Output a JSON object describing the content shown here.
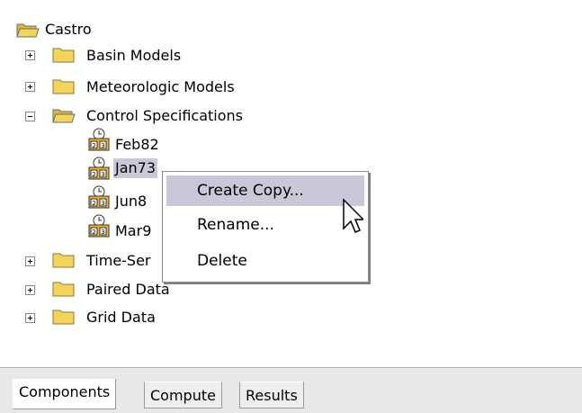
{
  "tree": {
    "root": {
      "label": "Castro",
      "icon": "open-folder-icon"
    },
    "nodes": [
      {
        "label": "Basin Models",
        "state": "collapsed",
        "icon": "folder-icon"
      },
      {
        "label": "Meteorologic Models",
        "state": "collapsed",
        "icon": "folder-icon"
      },
      {
        "label": "Control Specifications",
        "state": "expanded",
        "icon": "open-folder-icon",
        "children": [
          {
            "label": "Feb82",
            "icon": "calendar-clock-icon"
          },
          {
            "label": "Jan73",
            "icon": "calendar-clock-icon",
            "selected": true
          },
          {
            "label": "Jun8",
            "icon": "calendar-clock-icon"
          },
          {
            "label": "Mar9",
            "icon": "calendar-clock-icon"
          }
        ]
      },
      {
        "label": "Time-Ser",
        "state": "collapsed",
        "icon": "folder-icon"
      },
      {
        "label": "Paired Data",
        "state": "collapsed",
        "icon": "folder-icon"
      },
      {
        "label": "Grid Data",
        "state": "collapsed",
        "icon": "folder-icon"
      }
    ]
  },
  "context_menu": {
    "items": [
      {
        "label": "Create Copy...",
        "highlighted": true
      },
      {
        "label": "Rename..."
      },
      {
        "label": "Delete"
      }
    ]
  },
  "tabs": [
    {
      "label": "Components",
      "active": true
    },
    {
      "label": "Compute"
    },
    {
      "label": "Results"
    }
  ],
  "colors": {
    "selection": "#c8c8d8",
    "folder": "#f2d45a"
  }
}
